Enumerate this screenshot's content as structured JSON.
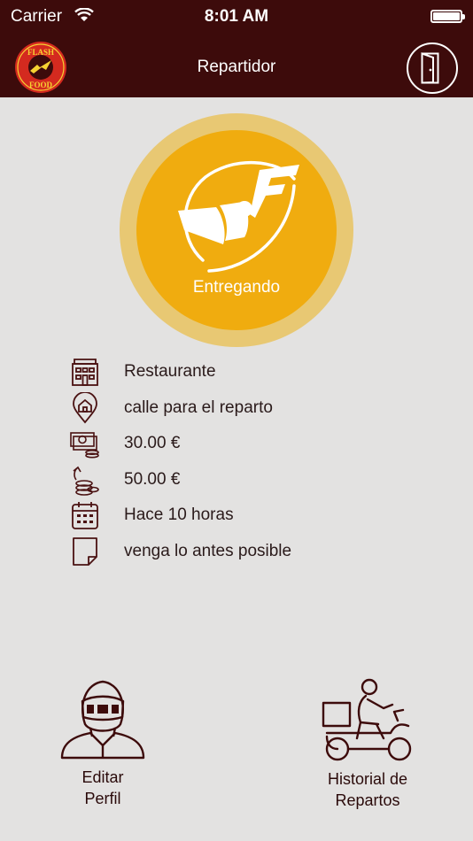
{
  "status_bar": {
    "carrier": "Carrier",
    "time": "8:01 AM"
  },
  "header": {
    "title": "Repartidor",
    "logo_text_top": "FLASH",
    "logo_text_bottom": "FOOD"
  },
  "order_status": {
    "label": "Entregando",
    "accent_color": "#f0ac0f"
  },
  "details": [
    {
      "icon": "building-icon",
      "text": "Restaurante"
    },
    {
      "icon": "location-pin-icon",
      "text": "calle para el reparto"
    },
    {
      "icon": "money-bills-icon",
      "text": "30.00 €"
    },
    {
      "icon": "coins-change-icon",
      "text": "50.00 €"
    },
    {
      "icon": "calendar-icon",
      "text": "Hace 10 horas"
    },
    {
      "icon": "note-icon",
      "text": "venga lo antes posible"
    }
  ],
  "actions": {
    "profile": {
      "line1": "Editar",
      "line2": "Perfil"
    },
    "history": {
      "line1": "Historial de",
      "line2": "Repartos"
    }
  },
  "colors": {
    "header": "#3d0b0b",
    "background": "#e3e2e1",
    "icon_stroke": "#4a1212"
  }
}
